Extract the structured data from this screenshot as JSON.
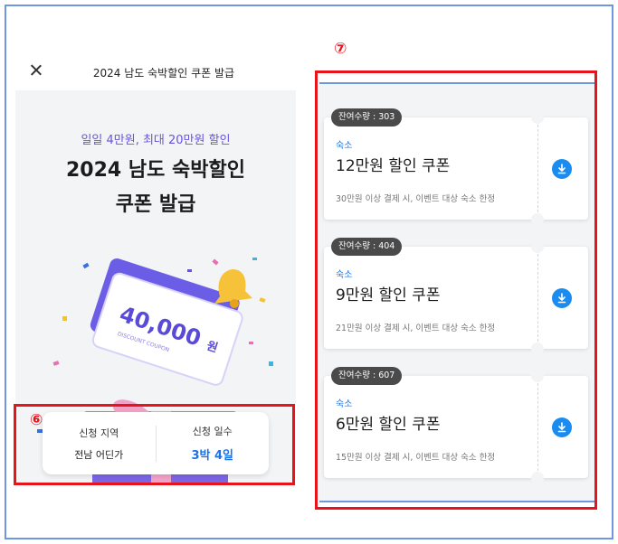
{
  "header": {
    "title": "2024 남도 숙박할인 쿠폰 발급"
  },
  "hero": {
    "subtitle": "일일 4만원, 최대 20만원 할인",
    "title_line1": "2024 남도 숙박할인",
    "title_line2": "쿠폰 발급",
    "coupon_amount": "40,000",
    "coupon_unit": "원",
    "coupon_caption": "DISCOUNT COUPON"
  },
  "info": {
    "region_label": "신청 지역",
    "region_value": "전남 어딘가",
    "days_label": "신청 일수",
    "days_value": "3박 4일"
  },
  "annotations": {
    "left_marker": "⑥",
    "right_marker": "⑦"
  },
  "coupons": [
    {
      "remaining": "잔여수량 : 303",
      "category": "숙소",
      "name": "12만원 할인 쿠폰",
      "condition": "30만원 이상 결제 시, 이벤트 대상 숙소 한정"
    },
    {
      "remaining": "잔여수량 : 404",
      "category": "숙소",
      "name": "9만원 할인 쿠폰",
      "condition": "21만원 이상 결제 시, 이벤트 대상 숙소 한정"
    },
    {
      "remaining": "잔여수량 : 607",
      "category": "숙소",
      "name": "6만원 할인 쿠폰",
      "condition": "15만원 이상 결제 시, 이벤트 대상 숙소 한정"
    }
  ],
  "colors": {
    "accent_blue": "#1a73e8",
    "accent_purple": "#6a52e0",
    "highlight_red": "#e8141b",
    "frame_blue": "#6f97e0"
  },
  "icons": {
    "close": "close-icon",
    "download": "download-icon"
  }
}
